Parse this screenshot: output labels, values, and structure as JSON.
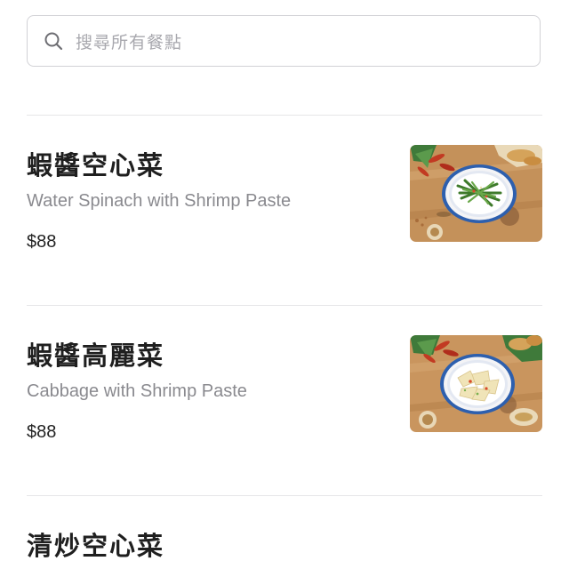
{
  "search": {
    "placeholder": "搜尋所有餐點",
    "icon": "search-icon"
  },
  "menu": {
    "items": [
      {
        "name": "蝦醬空心菜",
        "subtitle": "Water Spinach with Shrimp Paste",
        "price": "$88",
        "photo_icon": "water-spinach-dish-photo"
      },
      {
        "name": "蝦醬高麗菜",
        "subtitle": "Cabbage with Shrimp Paste",
        "price": "$88",
        "photo_icon": "cabbage-dish-photo"
      },
      {
        "name": "清炒空心菜"
      }
    ]
  },
  "colors": {
    "text_primary": "#1f1f1f",
    "text_secondary": "#8a8a8f",
    "border": "#d2d2d6",
    "divider": "#e6e6e8",
    "wood": "#c9955e",
    "plate_rim": "#2d5fae"
  }
}
